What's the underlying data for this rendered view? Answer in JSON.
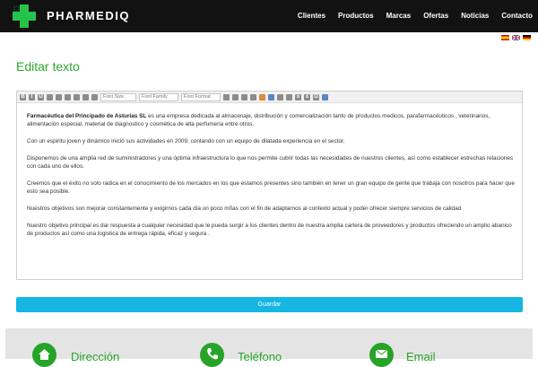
{
  "header": {
    "brand": "PHARMEDIQ",
    "nav": [
      "Clientes",
      "Productos",
      "Marcas",
      "Ofertas",
      "Noticias",
      "Contacto"
    ]
  },
  "languages": [
    "es",
    "en",
    "de"
  ],
  "page_title": "Editar texto",
  "toolbar": {
    "font_size": "Font Size",
    "font_family": "Font Family",
    "font_format": "Font Format"
  },
  "content": {
    "p1_bold": "Farmacéutica del Principado de Asturias SL",
    "p1_rest": " es una empresa dedicada al almacenaje, distribución y comercialización tanto de productos medicos,  parafarmacéuticos , veterinarios, alimentación especial, material de diagnostico  y cosmética de alta perfumeria entre otros.",
    "p2": "Con un espiritu joven y dinámico inició sus actividades en 2009, contando  con un equipo de dilatada experiencia en el sector.",
    "p3": " Disponemos  de una amplia red de suministradores  y   una óptima infraestructura  lo que nos permite cubrir todas las necesidades de nuestros clientes, así como establecer estrechas relaciones con cada uno de ellos.",
    "p4": " Creemos que el éxito no solo radica en el conocimiento de los mercados en los que estamos presentes sino también en tener un gran equipo de gente que trabaja con nosotros para hacer que esto sea posible.",
    "p5": "Nuestros objetivos  son mejorar constantemente y exigirnos cada día un poco mñas con el fin de adaptarnos al contexto actual  y poder ofrecer siempre servicios de calidad.",
    "p6": "Nuestro objetivo principal es dar respuesta a  cualquier  necesidad que le pueda surgir a los clientes dentro de nuestra amplia cartera de proveedores y productos ofreciendo un amplio abanico  de productos así como una logistica de entrega  rápida, eficaz y segura ."
  },
  "save_label": "Guardar",
  "footer": [
    "Dirección",
    "Teléfono",
    "Email"
  ],
  "colors": {
    "green": "#27a427",
    "save": "#15b6e2"
  }
}
